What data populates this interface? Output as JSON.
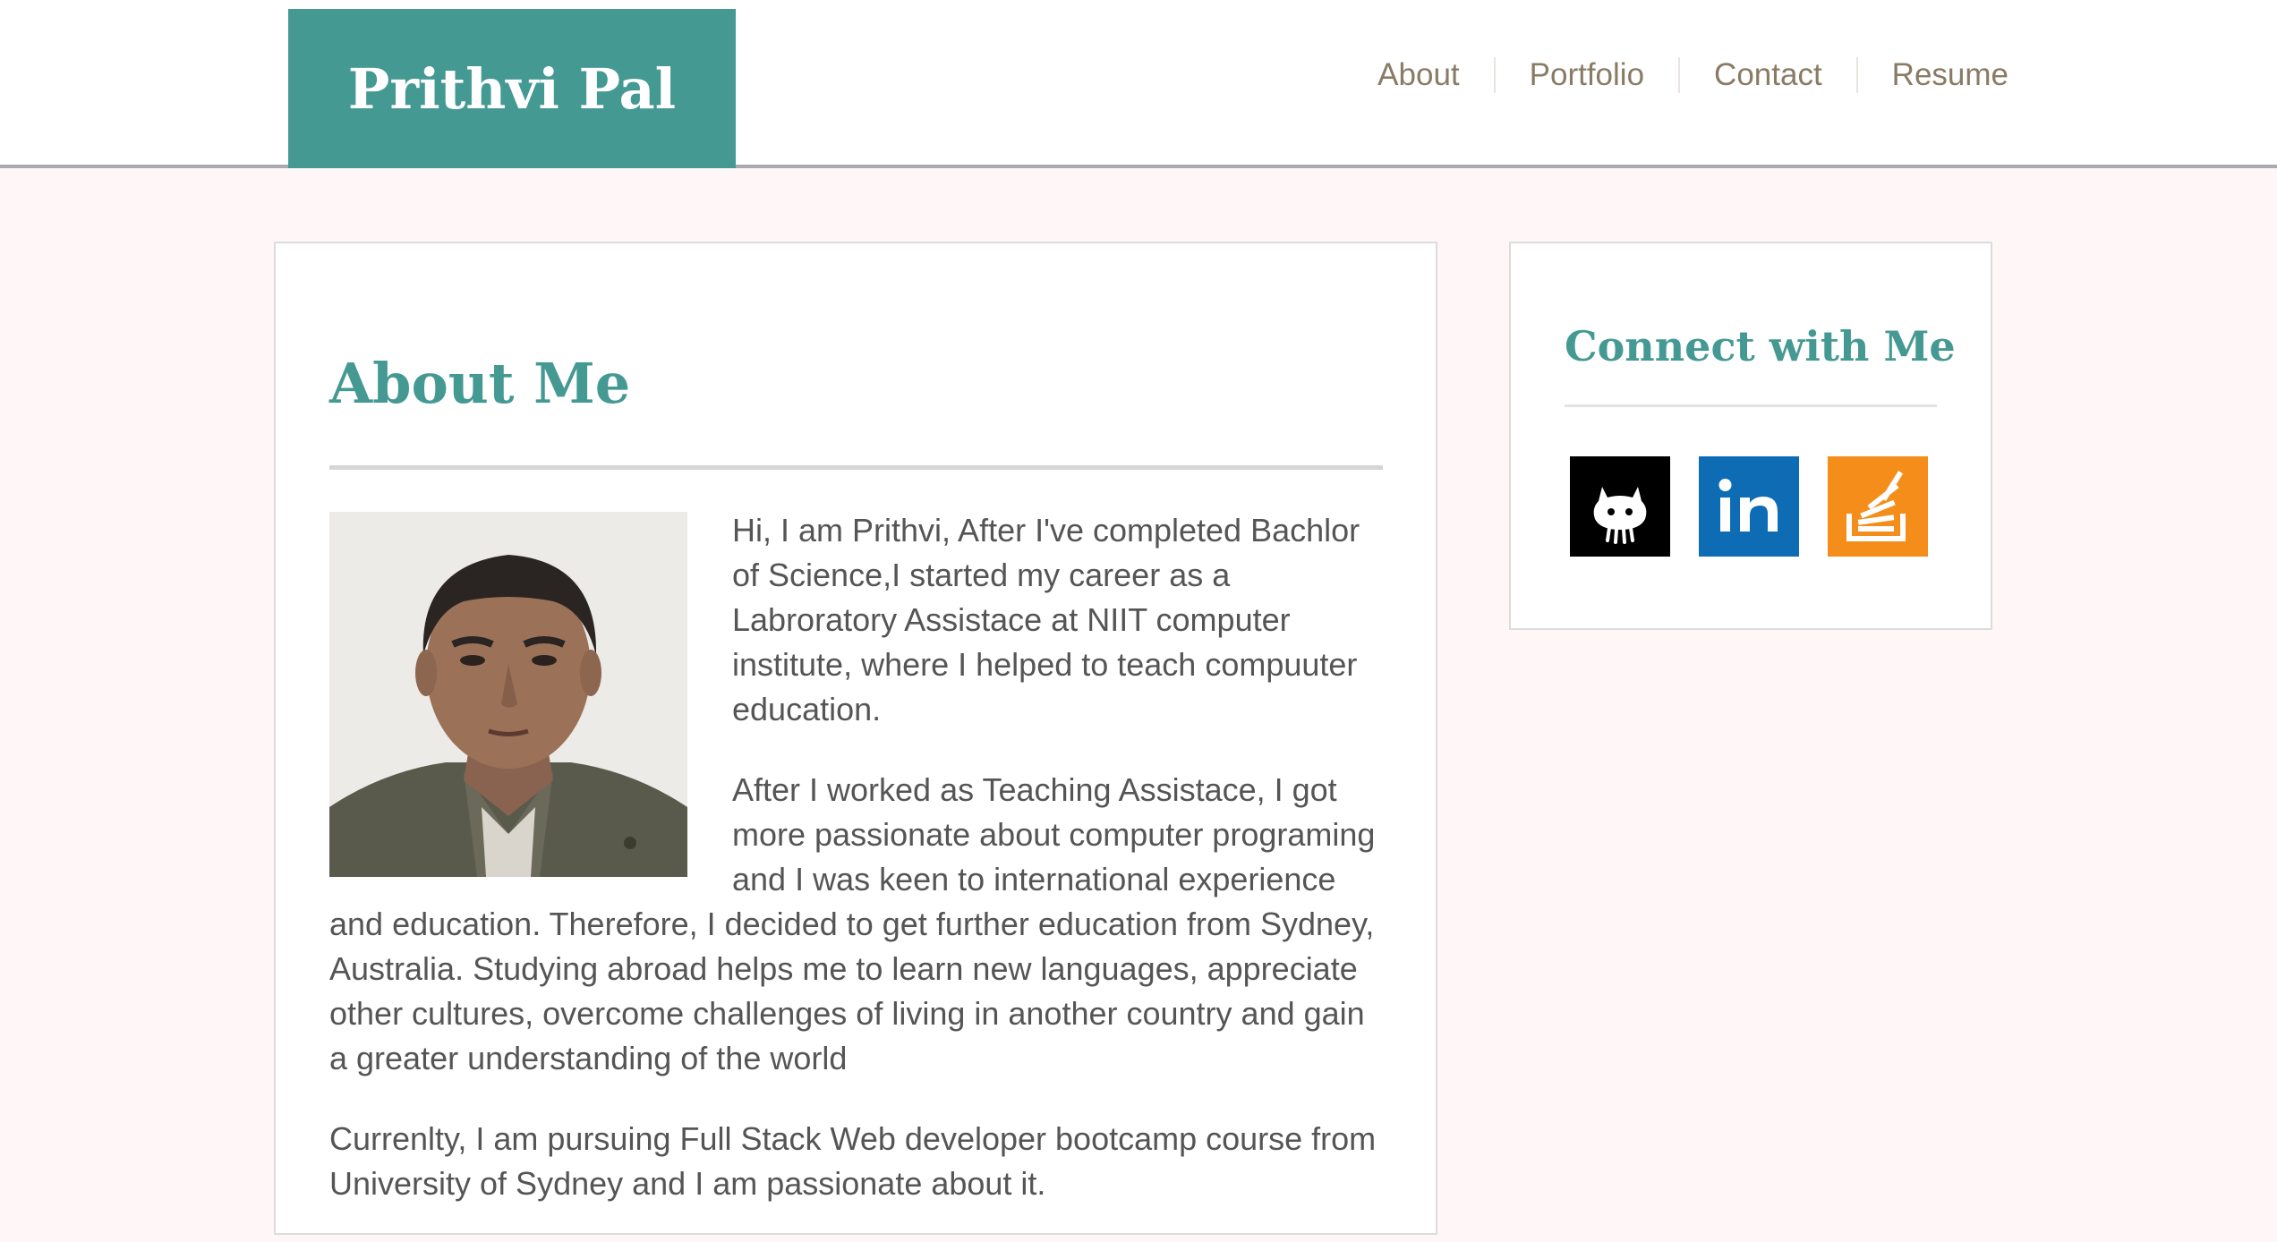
{
  "header": {
    "brand": "Prithvi Pal",
    "nav": [
      {
        "label": "About"
      },
      {
        "label": "Portfolio"
      },
      {
        "label": "Contact"
      },
      {
        "label": "Resume"
      }
    ]
  },
  "about": {
    "title": "About Me",
    "paragraphs": [
      "Hi, I am Prithvi, After I've completed Bachlor of Science,I started my career as a Labroratory Assistace at NIIT computer institute, where I helped to teach compuuter education.",
      "After I worked as Teaching Assistace, I got more passionate about computer programing and I was keen to international experience and education. Therefore, I decided to get further education from Sydney, Australia. Studying abroad helps me to learn new languages, appreciate other cultures, overcome challenges of living in another country and gain a greater understanding of the world",
      "Currenlty, I am pursuing Full Stack Web developer bootcamp course from University of Sydney and I am passionate about it."
    ]
  },
  "connect": {
    "title": "Connect with Me",
    "icons": [
      {
        "name": "github-icon",
        "color": "#000000"
      },
      {
        "name": "linkedin-icon",
        "color": "#0e6cb4"
      },
      {
        "name": "stackoverflow-icon",
        "color": "#f48d1a"
      }
    ]
  },
  "colors": {
    "accent": "#459993",
    "nav_text": "#8a7b65",
    "page_background": "#fff7f7",
    "body_text": "#555555"
  }
}
